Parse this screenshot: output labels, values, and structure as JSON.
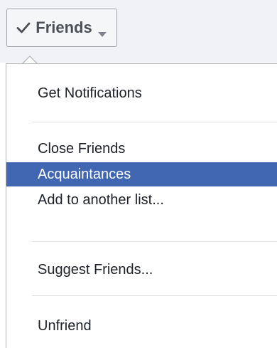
{
  "friends_button": {
    "label": "Friends",
    "check_icon": "checkmark-icon",
    "caret_icon": "caret-down-icon"
  },
  "menu": {
    "items": [
      {
        "label": "Get Notifications",
        "active": false
      },
      {
        "label": "Close Friends",
        "active": false
      },
      {
        "label": "Acquaintances",
        "active": true
      },
      {
        "label": "Add to another list...",
        "active": false
      },
      {
        "label": "Suggest Friends...",
        "active": false
      },
      {
        "label": "Unfriend",
        "active": false
      }
    ]
  },
  "colors": {
    "highlight": "#4267b2",
    "text": "#1d2129",
    "button_text": "#4b4f56",
    "divider": "#dddfe2"
  }
}
